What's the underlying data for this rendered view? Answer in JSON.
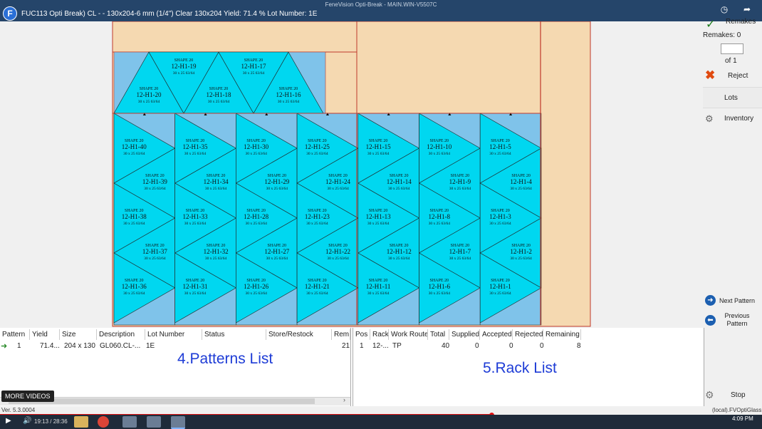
{
  "window": {
    "app_title": "FeneVision Opti-Break - MAIN.WIN-V5507C",
    "job_info": "FUC113 Opti Break) CL - - 130x204-6 mm (1/4\") Clear 130x204   Yield: 71.4 %   Lot Number: 1E"
  },
  "pieces": {
    "shape_label": "SHAPE 20",
    "size_label": "30 x 25 63/64",
    "top_row_ids": [
      "12-H1-20",
      "12-H1-19",
      "12-H1-18",
      "12-H1-17",
      "12-H1-16"
    ],
    "columns": [
      [
        "12-H1-40",
        "12-H1-39",
        "12-H1-38",
        "12-H1-37",
        "12-H1-36"
      ],
      [
        "12-H1-35",
        "12-H1-34",
        "12-H1-33",
        "12-H1-32",
        "12-H1-31"
      ],
      [
        "12-H1-30",
        "12-H1-29",
        "12-H1-28",
        "12-H1-27",
        "12-H1-26"
      ],
      [
        "12-H1-25",
        "12-H1-24",
        "12-H1-23",
        "12-H1-22",
        "12-H1-21"
      ],
      [
        "12-H1-15",
        "12-H1-14",
        "12-H1-13",
        "12-H1-12",
        "12-H1-11"
      ],
      [
        "12-H1-10",
        "12-H1-9",
        "12-H1-8",
        "12-H1-7",
        "12-H1-6"
      ],
      [
        "12-H1-5",
        "12-H1-4",
        "12-H1-3",
        "12-H1-2",
        "12-H1-1"
      ]
    ]
  },
  "colors": {
    "sheet_bg": "#f5d9b1",
    "piece_fill": "#00d7f0",
    "piece_bg": "#7fc3ea",
    "cut_line": "#c0392b",
    "accent_label": "#1e3cd6"
  },
  "right_panel": {
    "remakes_label": "Remakes",
    "remakes_count": "Remakes: 0",
    "of_label": "of 1",
    "reject_label": "Reject",
    "lots_label": "Lots",
    "inventory_label": "Inventory",
    "next_pattern_label": "Next Pattern",
    "previous_pattern_label": "Previous Pattern",
    "stop_label": "Stop"
  },
  "patterns_list": {
    "headers": [
      "Pattern",
      "Yield",
      "Size",
      "Description",
      "Lot Number",
      "Status",
      "Store/Restock",
      "Rem"
    ],
    "row": [
      "1",
      "71.4...",
      "204 x 130",
      "GL060.CL-...",
      "1E",
      "",
      "",
      "21"
    ]
  },
  "rack_list": {
    "headers": [
      "Pos",
      "Rack",
      "Work Route",
      "Total",
      "Supplied",
      "Accepted",
      "Rejected",
      "Remaining"
    ],
    "row": [
      "1",
      "12-...",
      "TP",
      "40",
      "0",
      "0",
      "0",
      "8"
    ]
  },
  "overlays": {
    "patterns_label": "4.Patterns List",
    "rack_label": "5.Rack List",
    "more_videos": "MORE VIDEOS"
  },
  "status_bar": {
    "version": "Ver. 5.3.0004",
    "server": "(local).FVOptiGlass"
  },
  "video": {
    "time": "19:13 / 28:36",
    "progress_fraction": 0.645,
    "clock": "4:09 PM"
  }
}
